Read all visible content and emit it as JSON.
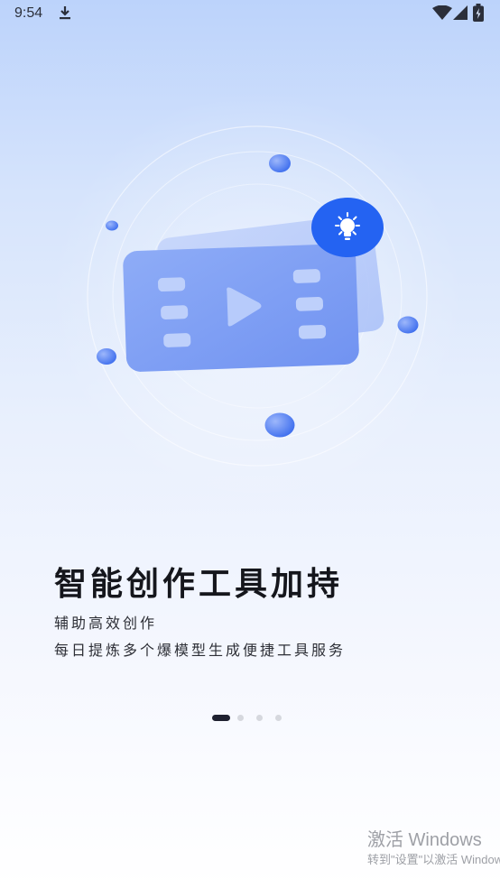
{
  "status_bar": {
    "time": "9:54",
    "icons": [
      "download-icon",
      "wifi-icon",
      "cellular-signal-icon",
      "battery-icon"
    ]
  },
  "illustration": {
    "icons": [
      "film-strip-icon",
      "play-icon",
      "lightbulb-icon"
    ],
    "colors": {
      "card": "#7d9ff5",
      "badge": "#1f5ff3",
      "orb": "#4a78f0"
    }
  },
  "onboarding": {
    "title": "智能创作工具加持",
    "subtitle_1": "辅助高效创作",
    "subtitle_2": "每日提炼多个爆模型生成便捷工具服务",
    "page_count": 4,
    "active_page": 1
  },
  "watermark": {
    "line1": "激活 Windows",
    "line2": "转到\"设置\"以激活 Windows。"
  }
}
